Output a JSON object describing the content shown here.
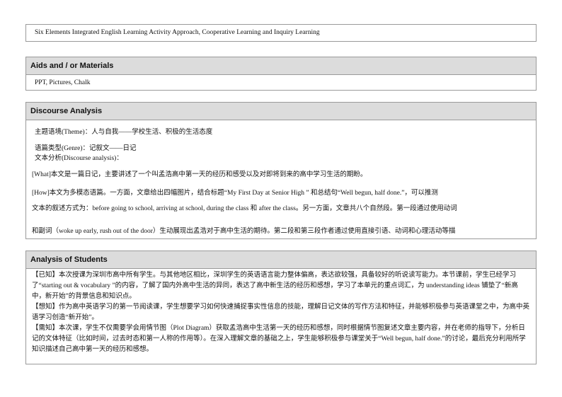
{
  "method": {
    "text": "Six Elements  Integrated  English  Learning  Activity  Approach, Cooperative Learning  and Inquiry  Learning"
  },
  "aids": {
    "title": "Aids and / or Materials",
    "text": "PPT, Pictures,  Chalk"
  },
  "discourse": {
    "title": "Discourse Analysis",
    "theme": "主题语境(Theme)：人与自我——学校生活、积极的生活态度",
    "genre": "语篇类型(Genre)：记叙文——日记",
    "analysis_label": "文本分析(Discourse  analysis)：",
    "what": "[What]本文是一篇日记，主要讲述了一个叫孟浩高中第一天的经历和感受以及对即将到来的高中学习生活的期盼。",
    "how_1": "[How]本文为多模态语篇。一方面，文章给出四幅图片，结合标题“My First Day at Senior High ” 和总结句“Well begun, half done.”，可以推测",
    "how_2": "文本的叙述方式为：before going  to school, arriving  at school, during  the class 和 after the class。另一方面，文章共八个自然段。第一段通过使用动词",
    "how_3": "和副词（woke up early, rush out of the door）生动展现出孟浩对于高中生活的期待。第二段和第三段作者通过使用直接引语、动词和心理活动等描"
  },
  "students": {
    "title": "Analysis of Students",
    "known": "【已知】本次授课为深圳市高中所有学生。与其他地区相比，深圳学生的英语语言能力整体偏高，表达欲较强，具备较好的听说读写能力。本节课前，学生已经学习了“starting  out & vocabulary ”的内容，了解了国内外高中生活的异同，表达了高中新生活的经历和感想，学习了本单元的重点词汇，为 understanding  ideas 铺垫了“新高中，新开始”的背景信息和知识点。",
    "want": "【想知】作为高中英语学习的第一节阅读课，学生想要学习如何快速捕捉事实性信息的技能，理解日记文体的写作方法和特征，并能够积极参与英语课堂之中，为高中英语学习创造“新开始”。",
    "need": "【需知】本次课，学生不仅需要学会用情节图（Plot Diagram）获取孟浩高中生活第一天的经历和感想，同时根据情节图复述文章主要内容，并在老师的指导下，分析日记的文体特征（比如时间，过去时态和第一人称的作用等）。在深入理解文章的基础之上，学生能够积极参与课堂关于“Well begun, half  done.”的讨论，最后充分利用所学知识描述自己高中第一天的经历和感想。"
  }
}
